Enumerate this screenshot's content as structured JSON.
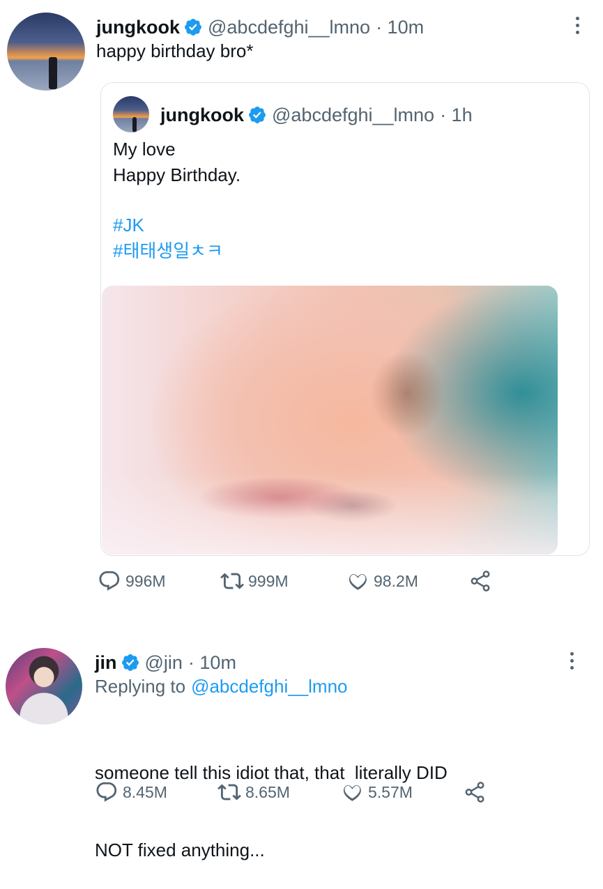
{
  "tweet1": {
    "name": "jungkook",
    "handle": "@abcdefghi__lmno",
    "time": "· 10m",
    "text": "happy birthday bro*",
    "quoted": {
      "name": "jungkook",
      "handle": "@abcdefghi__lmno",
      "time": "· 1h",
      "line1": "My love",
      "line2": "Happy Birthday.",
      "tag1": "#JK",
      "tag2": "#태태생일ㅊㅋ"
    },
    "stats": {
      "replies": "996M",
      "retweets": "999M",
      "likes": "98.2M"
    }
  },
  "tweet2": {
    "name": "jin",
    "handle": "@jin",
    "time": "· 10m",
    "replying_prefix": "Replying to",
    "replying_handle": "@abcdefghi__lmno",
    "line1": "someone tell this idiot that, that  literally DID",
    "line2": "NOT fixed anything...",
    "stats": {
      "replies": "8.45M",
      "retweets": "8.65M",
      "likes": "5.57M"
    }
  },
  "colors": {
    "accent": "#1d9bf0",
    "secondary": "#536471",
    "border": "#dfe3e8"
  },
  "icons": [
    "verified-badge-icon",
    "more-icon",
    "reply-icon",
    "retweet-icon",
    "like-icon",
    "share-icon"
  ]
}
